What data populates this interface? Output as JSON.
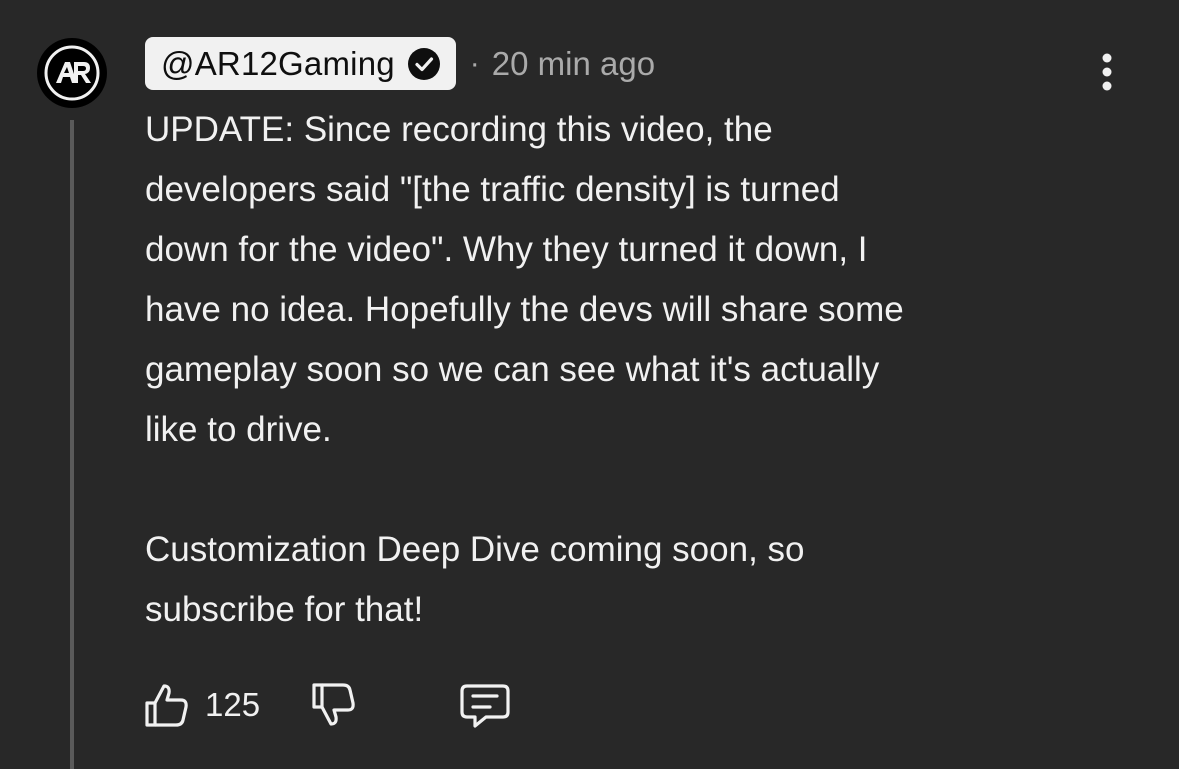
{
  "author": {
    "handle": "@AR12Gaming",
    "avatar_logo_text": "AR",
    "verified": true
  },
  "meta": {
    "separator": "·",
    "timestamp": "20 min ago"
  },
  "comment": {
    "paragraphs": [
      "UPDATE: Since recording this video, the\ndevelopers said \"[the traffic density] is turned\ndown for the video\". Why they turned it down, I\nhave no idea. Hopefully the devs will share some\ngameplay soon so we can see what it's actually\nlike to drive.",
      "Customization Deep Dive coming soon, so\nsubscribe for that!"
    ]
  },
  "actions": {
    "like_count": "125",
    "like_icon": "thumbs-up-icon",
    "dislike_icon": "thumbs-down-icon",
    "reply_icon": "comment-icon",
    "menu_icon": "more-vertical-icon"
  },
  "colors": {
    "background": "#282828",
    "text": "#f1f1f1",
    "secondary_text": "#aaaaaa",
    "chip_background": "#f1f1f1",
    "thread_line": "#5a5a5a"
  }
}
